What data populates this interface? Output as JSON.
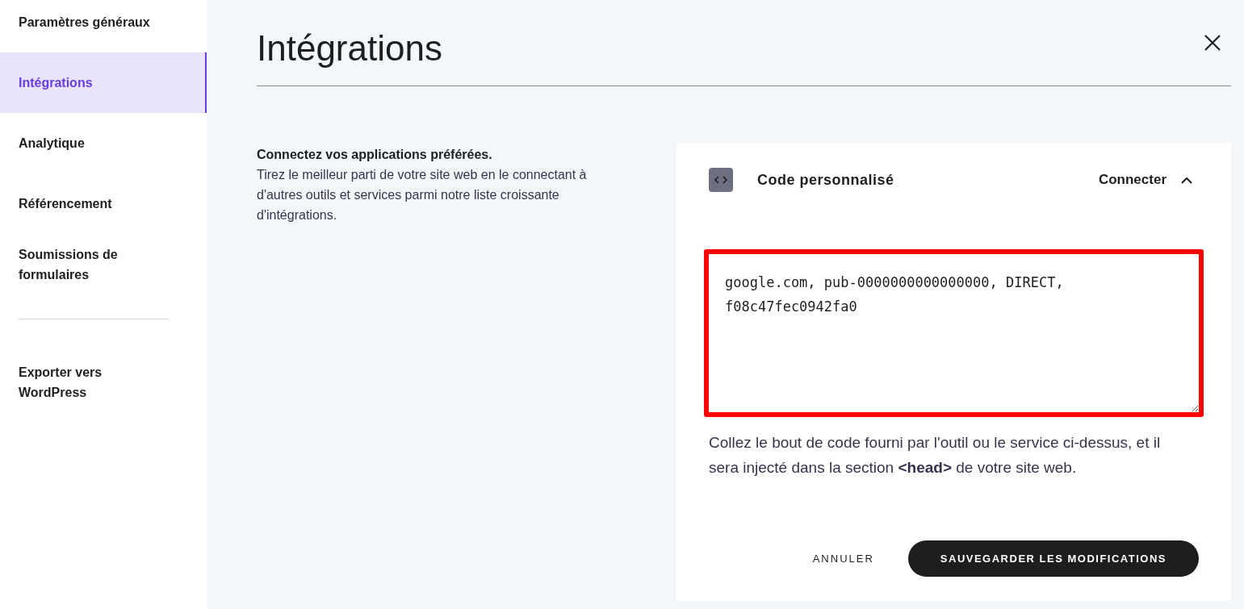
{
  "sidebar": {
    "items": [
      {
        "label": "Paramètres généraux",
        "selected": false
      },
      {
        "label": "Intégrations",
        "selected": true
      },
      {
        "label": "Analytique",
        "selected": false
      },
      {
        "label": "Référencement",
        "selected": false
      },
      {
        "label": "Soumissions de formulaires",
        "selected": false
      }
    ],
    "footer_items": [
      {
        "label": "Exporter vers WordPress",
        "selected": false
      }
    ]
  },
  "page": {
    "title": "Intégrations"
  },
  "intro": {
    "heading": "Connectez vos applications préférées.",
    "body": "Tirez le meilleur parti de votre site web en le connectant à d'autres outils et services parmi notre liste croissante d'intégrations."
  },
  "integration": {
    "name": "Code personnalisé",
    "action": "Connecter",
    "expanded": true,
    "code_field": {
      "value": "google.com, pub-0000000000000000, DIRECT, f08c47fec0942fa0",
      "highlighted": true
    },
    "help": "Collez le bout de code fourni par l'outil ou le service ci-dessus, et il sera injecté dans la section **<head>** de votre site web.",
    "buttons": {
      "cancel": "ANNULER",
      "save": "SAUVEGARDER LES MODIFICATIONS"
    }
  }
}
